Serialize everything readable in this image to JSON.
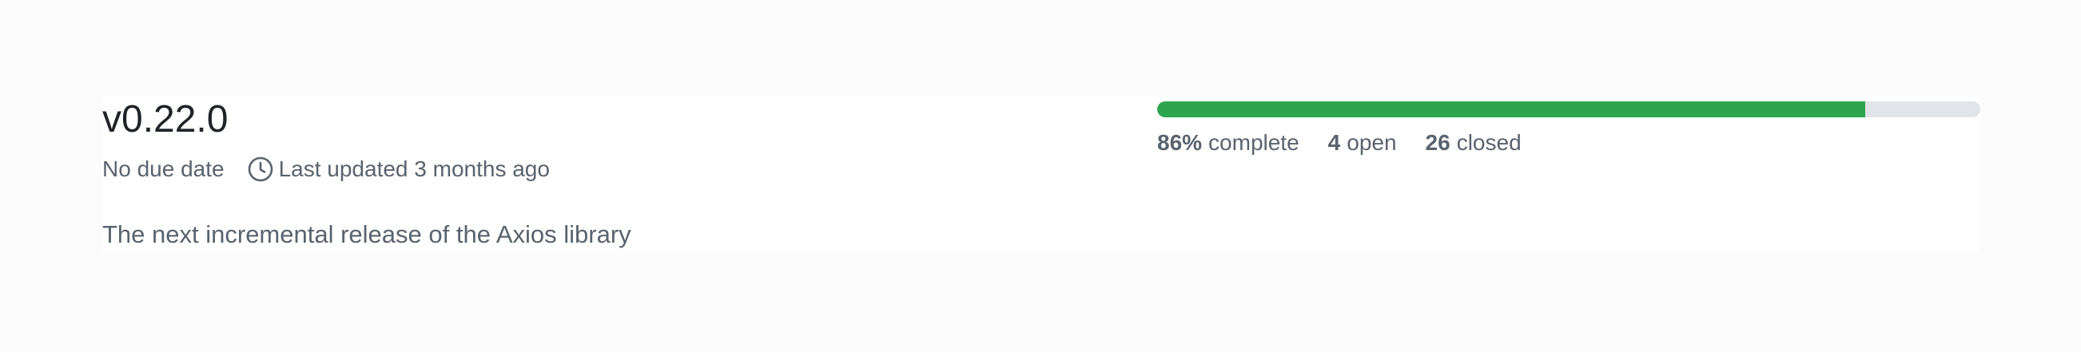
{
  "milestone": {
    "title": "v0.22.0",
    "due": "No due date",
    "updated": "Last updated 3 months ago",
    "description": "The next incremental release of the Axios library"
  },
  "progress": {
    "percent_value": 86,
    "percent": "86%",
    "complete_label": "complete",
    "open_count": "4",
    "open_label": "open",
    "closed_count": "26",
    "closed_label": "closed"
  },
  "colors": {
    "progress_fill": "#2da44e",
    "progress_track": "#e1e4e8",
    "muted_text": "#59636e"
  },
  "icons": {
    "updated": "clock-icon"
  }
}
